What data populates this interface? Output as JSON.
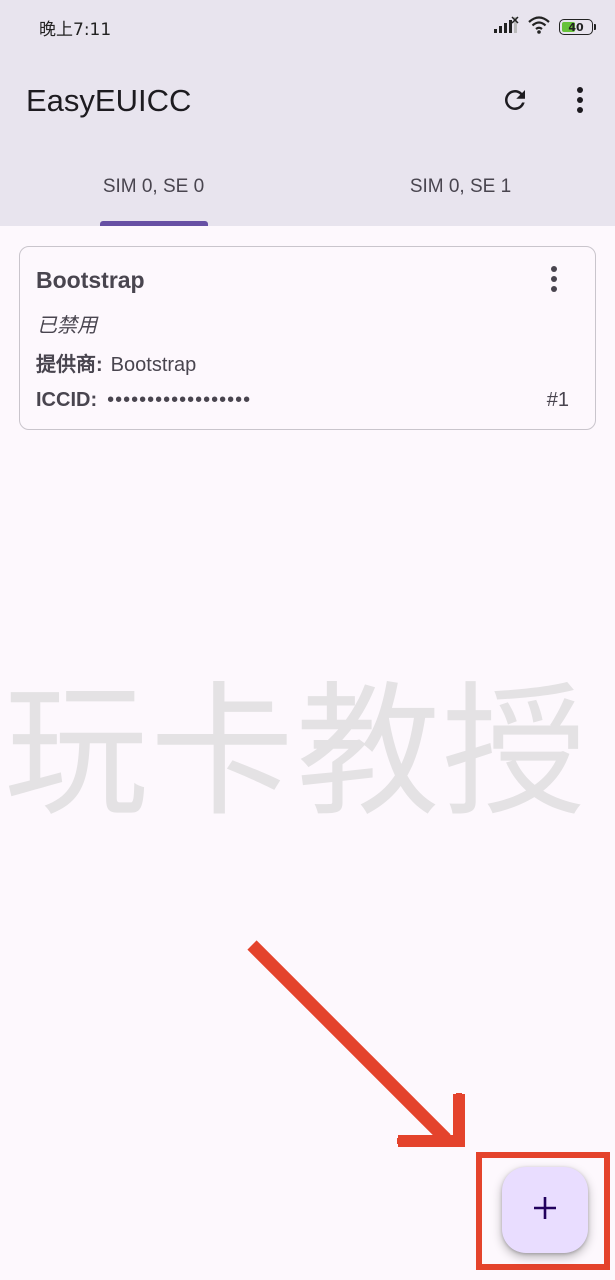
{
  "status_bar": {
    "time": "晚上7:11",
    "battery_level": "40",
    "battery_fraction": 0.4,
    "icons": [
      "signal-icon",
      "wifi-icon",
      "battery-icon"
    ]
  },
  "app_bar": {
    "title": "EasyEUICC",
    "actions": [
      "refresh-icon",
      "more-vert-icon"
    ]
  },
  "tabs": [
    {
      "label": "SIM 0, SE 0",
      "selected": true
    },
    {
      "label": "SIM 0, SE 1",
      "selected": false
    }
  ],
  "profile": {
    "name": "Bootstrap",
    "state": "已禁用",
    "provider_label": "提供商:",
    "provider_value": "Bootstrap",
    "iccid_label": "ICCID:",
    "iccid_value": "••••••••••••••••••",
    "index": "#1"
  },
  "watermark": "玩卡教授",
  "fab": {
    "icon": "add-icon"
  },
  "colors": {
    "app_bar_bg": "#e8e4ee",
    "background": "#fdf8fd",
    "tab_indicator": "#6750a4",
    "fab_bg": "#e9ddff",
    "annotation_red": "#e4432c",
    "battery_green": "#66c23a"
  }
}
